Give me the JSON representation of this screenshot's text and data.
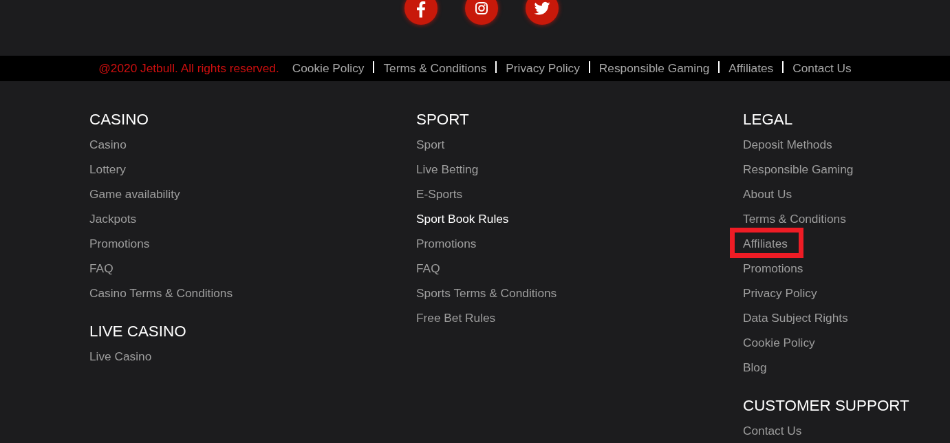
{
  "social_links": [
    {
      "kind": "facebook"
    },
    {
      "kind": "instagram"
    },
    {
      "kind": "twitter"
    }
  ],
  "bottom_bar": {
    "copyright": "@2020 Jetbull. All rights reserved.",
    "links": [
      "Cookie Policy",
      "Terms & Conditions",
      "Privacy Policy",
      "Responsible Gaming",
      "Affiliates",
      "Contact Us"
    ]
  },
  "columns": [
    {
      "sections": [
        {
          "heading": "CASINO",
          "links": [
            {
              "label": "Casino",
              "active": false,
              "highlighted": false
            },
            {
              "label": "Lottery",
              "active": false,
              "highlighted": false
            },
            {
              "label": "Game availability",
              "active": false,
              "highlighted": false
            },
            {
              "label": "Jackpots",
              "active": false,
              "highlighted": false
            },
            {
              "label": "Promotions",
              "active": false,
              "highlighted": false
            },
            {
              "label": "FAQ",
              "active": false,
              "highlighted": false
            },
            {
              "label": "Casino Terms & Conditions",
              "active": false,
              "highlighted": false
            }
          ]
        },
        {
          "heading": "LIVE CASINO",
          "links": [
            {
              "label": "Live Casino",
              "active": false,
              "highlighted": false
            }
          ]
        }
      ]
    },
    {
      "sections": [
        {
          "heading": "SPORT",
          "links": [
            {
              "label": "Sport",
              "active": false,
              "highlighted": false
            },
            {
              "label": "Live Betting",
              "active": false,
              "highlighted": false
            },
            {
              "label": "E-Sports",
              "active": false,
              "highlighted": false
            },
            {
              "label": "Sport Book Rules",
              "active": true,
              "highlighted": false
            },
            {
              "label": "Promotions",
              "active": false,
              "highlighted": false
            },
            {
              "label": "FAQ",
              "active": false,
              "highlighted": false
            },
            {
              "label": "Sports Terms & Conditions",
              "active": false,
              "highlighted": false
            },
            {
              "label": "Free Bet Rules",
              "active": false,
              "highlighted": false
            }
          ]
        }
      ]
    },
    {
      "sections": [
        {
          "heading": "LEGAL",
          "links": [
            {
              "label": "Deposit Methods",
              "active": false,
              "highlighted": false
            },
            {
              "label": "Responsible Gaming",
              "active": false,
              "highlighted": false
            },
            {
              "label": "About Us",
              "active": false,
              "highlighted": false
            },
            {
              "label": "Terms & Conditions",
              "active": false,
              "highlighted": false
            },
            {
              "label": "Affiliates",
              "active": false,
              "highlighted": true
            },
            {
              "label": "Promotions",
              "active": false,
              "highlighted": false
            },
            {
              "label": "Privacy Policy",
              "active": false,
              "highlighted": false
            },
            {
              "label": "Data Subject Rights",
              "active": false,
              "highlighted": false
            },
            {
              "label": "Cookie Policy",
              "active": false,
              "highlighted": false
            },
            {
              "label": "Blog",
              "active": false,
              "highlighted": false
            }
          ]
        },
        {
          "heading": "CUSTOMER SUPPORT",
          "links": [
            {
              "label": "Contact Us",
              "active": false,
              "highlighted": false
            }
          ]
        }
      ]
    }
  ]
}
